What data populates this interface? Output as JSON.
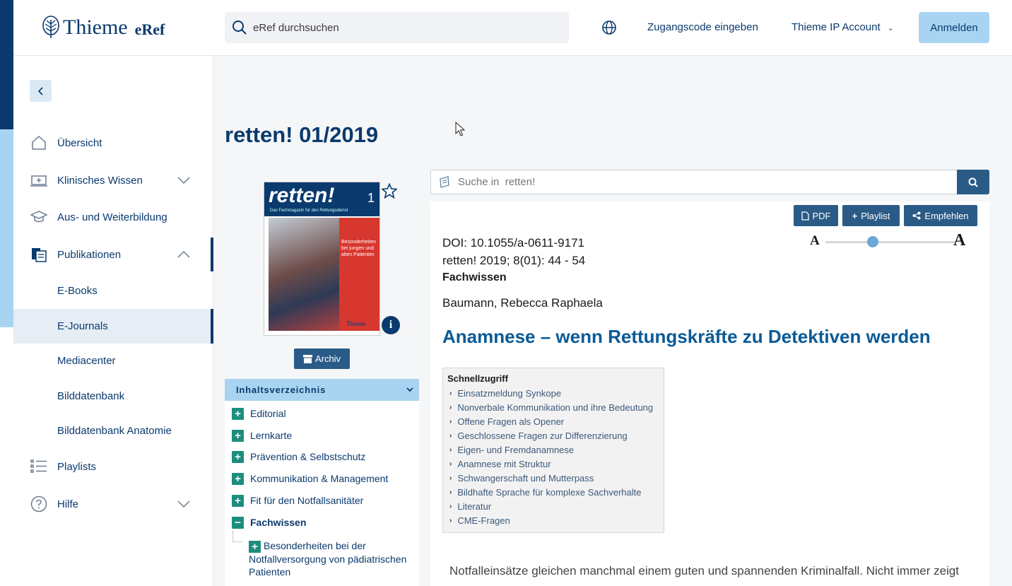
{
  "header": {
    "brand": "Thieme",
    "brand_sub": "eRef",
    "search_placeholder": "eRef durchsuchen",
    "access_code": "Zugangscode eingeben",
    "ip_account": "Thieme IP Account",
    "login": "Anmelden"
  },
  "sidebar": {
    "items": [
      {
        "label": "Übersicht",
        "icon": "home-icon"
      },
      {
        "label": "Klinisches Wissen",
        "icon": "clinical-icon"
      },
      {
        "label": "Aus- und Weiterbildung",
        "icon": "graduation-cap-icon"
      },
      {
        "label": "Publikationen",
        "icon": "publications-icon"
      },
      {
        "label": "E-Books"
      },
      {
        "label": "E-Journals"
      },
      {
        "label": "Mediacenter"
      },
      {
        "label": "Bilddatenbank"
      },
      {
        "label": "Bilddatenbank Anatomie"
      },
      {
        "label": "Playlists",
        "icon": "list-icon"
      },
      {
        "label": "Hilfe",
        "icon": "help-icon"
      }
    ]
  },
  "page": {
    "title": "retten! 01/2019"
  },
  "cover": {
    "title": "retten!",
    "issue": "1",
    "subtitle": "Das Fachmagazin für den Rettungsdienst",
    "headline": "Besonderheiten bei jungen und alten Patienten",
    "publisher": "Thieme"
  },
  "archive_label": "Archiv",
  "toc": {
    "title": "Inhaltsverzeichnis",
    "items": [
      {
        "label": "Editorial",
        "state": "+"
      },
      {
        "label": "Lernkarte",
        "state": "+"
      },
      {
        "label": "Prävention & Selbstschutz",
        "state": "+"
      },
      {
        "label": "Kommunikation & Management",
        "state": "+"
      },
      {
        "label": "Fit für den Notfallsanitäter",
        "state": "+"
      },
      {
        "label": "Fachwissen",
        "state": "−"
      }
    ],
    "sub_item": "Besonderheiten bei der Notfallversorgung von pädiatrischen Patienten",
    "sub_state": "+"
  },
  "journal_search": {
    "placeholder": "Suche in  retten!"
  },
  "article": {
    "buttons": {
      "pdf": "PDF",
      "playlist": "Playlist",
      "share": "Empfehlen"
    },
    "font_small": "A",
    "font_large": "A",
    "font_size_level": 0.35,
    "doi": "DOI: 10.1055/a-0611-9171",
    "citation": "retten! 2019; 8(01): 44 - 54",
    "category": "Fachwissen",
    "author": "Baumann, Rebecca Raphaela",
    "title": "Anamnese – wenn Rettungskräfte zu Detektiven werden",
    "quick_access": {
      "title": "Schnellzugriff",
      "items": [
        "Einsatzmeldung Synkope",
        "Nonverbale Kommunikation und ihre Bedeutung",
        "Offene Fragen als Opener",
        "Geschlossene Fragen zur Differenzierung",
        "Eigen- und Fremdanamnese",
        "Anamnese mit Struktur",
        "Schwangerschaft und Mutterpass",
        "Bildhafte Sprache für komplexe Sachverhalte",
        "Literatur",
        "CME-Fragen"
      ]
    },
    "body": "Notfalleinsätze gleichen manchmal einem guten und spannenden Kriminalfall. Nicht immer zeigt"
  },
  "colors": {
    "brand_dark": "#0a3a6e",
    "brand_light": "#a8d4f2",
    "button": "#2a5b86",
    "toc_plus": "#1d8e7e"
  }
}
